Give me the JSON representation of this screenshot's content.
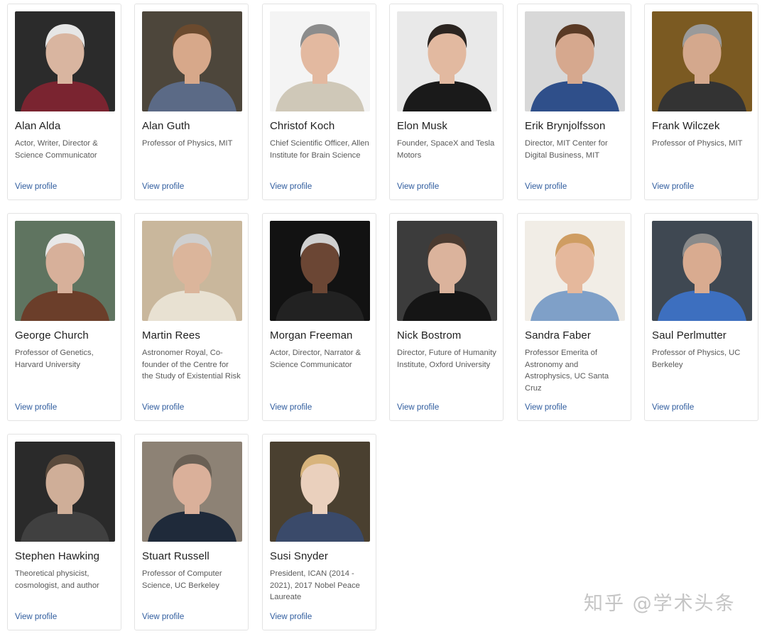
{
  "link_label": "View profile",
  "people": [
    {
      "name": "Alan Alda",
      "title": "Actor, Writer, Director & Science Communicator",
      "photo": {
        "bg": "#2b2b2b",
        "skin": "#d9b5a0",
        "hair": "#e6e6e6",
        "shirt": "#7a2430"
      }
    },
    {
      "name": "Alan Guth",
      "title": "Professor of Physics, MIT",
      "photo": {
        "bg": "#4d463b",
        "skin": "#d7a88a",
        "hair": "#6b4a2e",
        "shirt": "#5b6a86"
      }
    },
    {
      "name": "Christof Koch",
      "title": "Chief Scientific Officer, Allen Institute for Brain Science",
      "photo": {
        "bg": "#f4f4f4",
        "skin": "#e3b9a0",
        "hair": "#8c8c8c",
        "shirt": "#cfc8b8"
      }
    },
    {
      "name": "Elon Musk",
      "title": "Founder, SpaceX and Tesla Motors",
      "photo": {
        "bg": "#e9e9e9",
        "skin": "#e2b9a0",
        "hair": "#2b2420",
        "shirt": "#1a1a1a"
      }
    },
    {
      "name": "Erik Brynjolfsson",
      "title": "Director, MIT Center for Digital Business, MIT",
      "photo": {
        "bg": "#d8d8d8",
        "skin": "#d6a88e",
        "hair": "#5a3a25",
        "shirt": "#2f4f8a"
      }
    },
    {
      "name": "Frank Wilczek",
      "title": "Professor of Physics, MIT",
      "photo": {
        "bg": "#7b5a22",
        "skin": "#d4a88d",
        "hair": "#9a9a9a",
        "shirt": "#333333"
      }
    },
    {
      "name": "George Church",
      "title": "Professor of Genetics, Harvard University",
      "photo": {
        "bg": "#5f7460",
        "skin": "#d7b09a",
        "hair": "#e8e8e8",
        "shirt": "#6b3e2a"
      }
    },
    {
      "name": "Martin Rees",
      "title": "Astronomer Royal, Co-founder of the Centre for the Study of Existential Risk",
      "photo": {
        "bg": "#c9b79c",
        "skin": "#dbb59b",
        "hair": "#cfcfcf",
        "shirt": "#e8e1d2"
      }
    },
    {
      "name": "Morgan Freeman",
      "title": "Actor, Director, Narrator & Science Communicator",
      "photo": {
        "bg": "#121212",
        "skin": "#6b4634",
        "hair": "#d0d0d0",
        "shirt": "#222222"
      }
    },
    {
      "name": "Nick Bostrom",
      "title": "Director, Future of Humanity Institute, Oxford University",
      "photo": {
        "bg": "#3c3c3c",
        "skin": "#dbb39c",
        "hair": "#4a3a30",
        "shirt": "#151515"
      }
    },
    {
      "name": "Sandra Faber",
      "title": "Professor Emerita of Astronomy and Astrophysics, UC Santa Cruz",
      "photo": {
        "bg": "#f1ede6",
        "skin": "#e5b89c",
        "hair": "#cf9d62",
        "shirt": "#7fa0c8"
      }
    },
    {
      "name": "Saul Perlmutter",
      "title": "Professor of Physics, UC Berkeley",
      "photo": {
        "bg": "#3f4852",
        "skin": "#d9ab90",
        "hair": "#8a8a8a",
        "shirt": "#3d6fbf"
      }
    },
    {
      "name": "Stephen Hawking",
      "title": "Theoretical physicist, cosmologist, and author",
      "photo": {
        "bg": "#2a2a2a",
        "skin": "#cfae98",
        "hair": "#5a4a3c",
        "shirt": "#404040"
      }
    },
    {
      "name": "Stuart Russell",
      "title": "Professor of Computer Science, UC Berkeley",
      "photo": {
        "bg": "#8d8275",
        "skin": "#dab09a",
        "hair": "#6a6055",
        "shirt": "#1f2a3a"
      }
    },
    {
      "name": "Susi Snyder",
      "title": "President, ICAN (2014 - 2021), 2017 Nobel Peace Laureate",
      "photo": {
        "bg": "#4a4030",
        "skin": "#ead0bd",
        "hair": "#d8b47c",
        "shirt": "#3a4a6a"
      }
    }
  ],
  "watermark": "知乎 @学术头条"
}
